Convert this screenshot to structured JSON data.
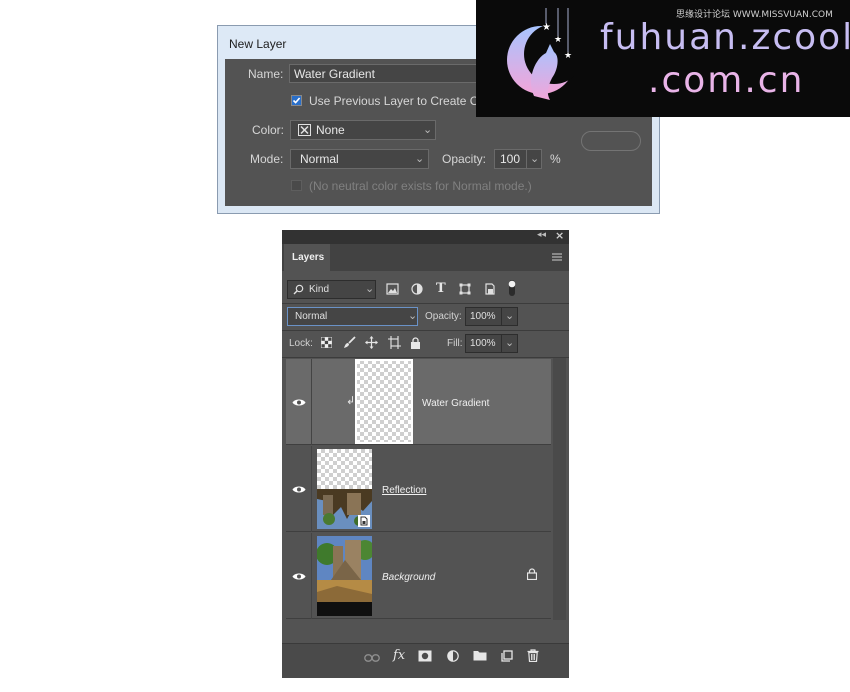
{
  "dialog": {
    "title": "New Layer",
    "name_label": "Name:",
    "name_value": "Water Gradient",
    "clip_checkbox_label": "Use Previous Layer to Create C",
    "clip_checked": true,
    "color_label": "Color:",
    "color_value": "None",
    "mode_label": "Mode:",
    "mode_value": "Normal",
    "opacity_label": "Opacity:",
    "opacity_value": "100",
    "opacity_unit": "%",
    "neutral_label": "(No neutral color exists for Normal mode.)"
  },
  "watermark": {
    "line1": "fuhuan.zcool",
    "line2": ".com.cn",
    "small_text": "思缘设计论坛 WWW.MISSVUAN.COM"
  },
  "panel": {
    "tab_label": "Layers",
    "filter_label": "Kind",
    "blend_mode": "Normal",
    "opacity_label": "Opacity:",
    "opacity_value": "100%",
    "lock_label": "Lock:",
    "fill_label": "Fill:",
    "fill_value": "100%",
    "layers": [
      {
        "name": "Water Gradient",
        "selected": true,
        "clipped": true
      },
      {
        "name": "Reflection",
        "selected": false,
        "smart_object": true
      },
      {
        "name": "Background",
        "selected": false,
        "locked": true
      }
    ],
    "footer_fx": "fx"
  }
}
